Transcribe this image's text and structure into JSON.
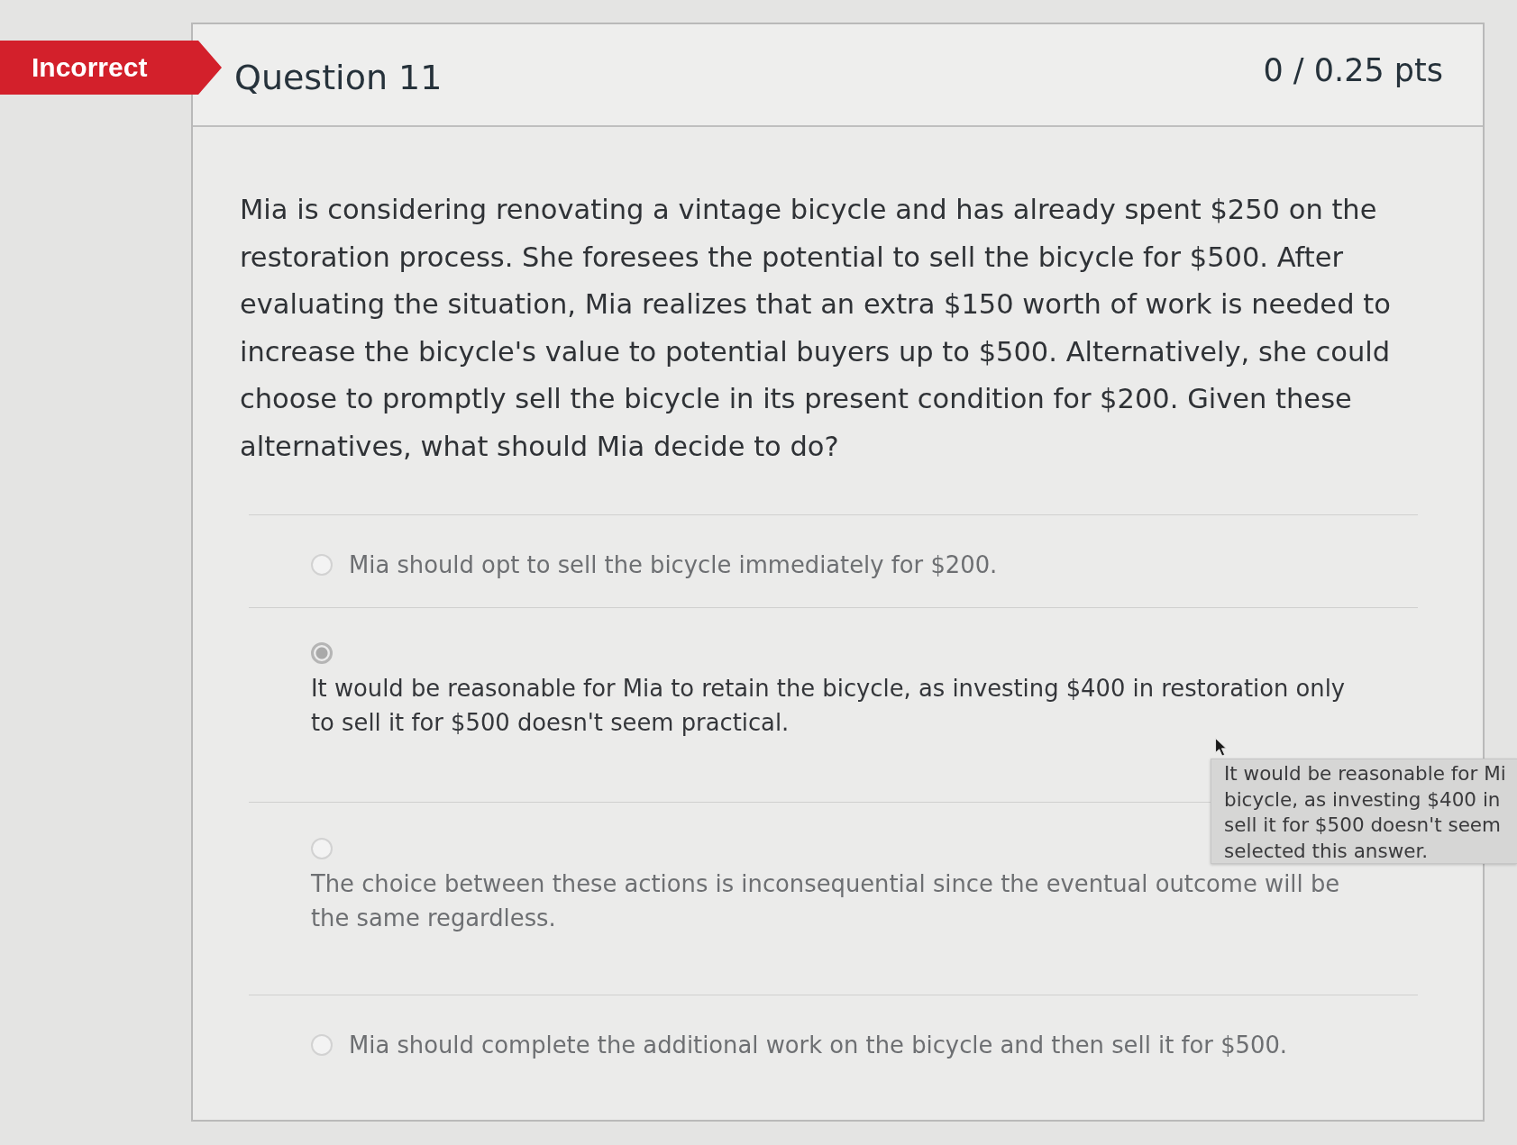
{
  "result_badge": {
    "label": "Incorrect"
  },
  "question": {
    "title": "Question 11",
    "points": "0 / 0.25 pts",
    "text": "Mia is considering renovating a vintage bicycle and has already spent $250 on the restoration process. She foresees the potential to sell the bicycle for $500. After evaluating the situation, Mia realizes that an extra $150 worth of work is needed to increase the bicycle's value to potential buyers up to $500. Alternatively, she could choose to promptly sell the bicycle in its present condition for $200. Given these alternatives, what should Mia decide to do?"
  },
  "answers": [
    {
      "kind": "inline",
      "text": "Mia should opt to sell the bicycle immediately for $200.",
      "selected": false
    },
    {
      "kind": "stacked",
      "text": "It would be reasonable for Mia to retain the bicycle, as investing $400 in restoration only to sell it for $500 doesn't seem practical.",
      "selected": true
    },
    {
      "kind": "stacked",
      "text": "The choice between these actions is inconsequential since the eventual outcome will be the same regardless.",
      "selected": false
    },
    {
      "kind": "inline",
      "text": "Mia should complete the additional work on the bicycle and then sell it for $500.",
      "selected": false
    }
  ],
  "tooltip": {
    "lines": [
      "It would be reasonable for Mi",
      "bicycle, as investing $400 in",
      "sell it for $500 doesn't seem",
      "selected this answer."
    ]
  }
}
